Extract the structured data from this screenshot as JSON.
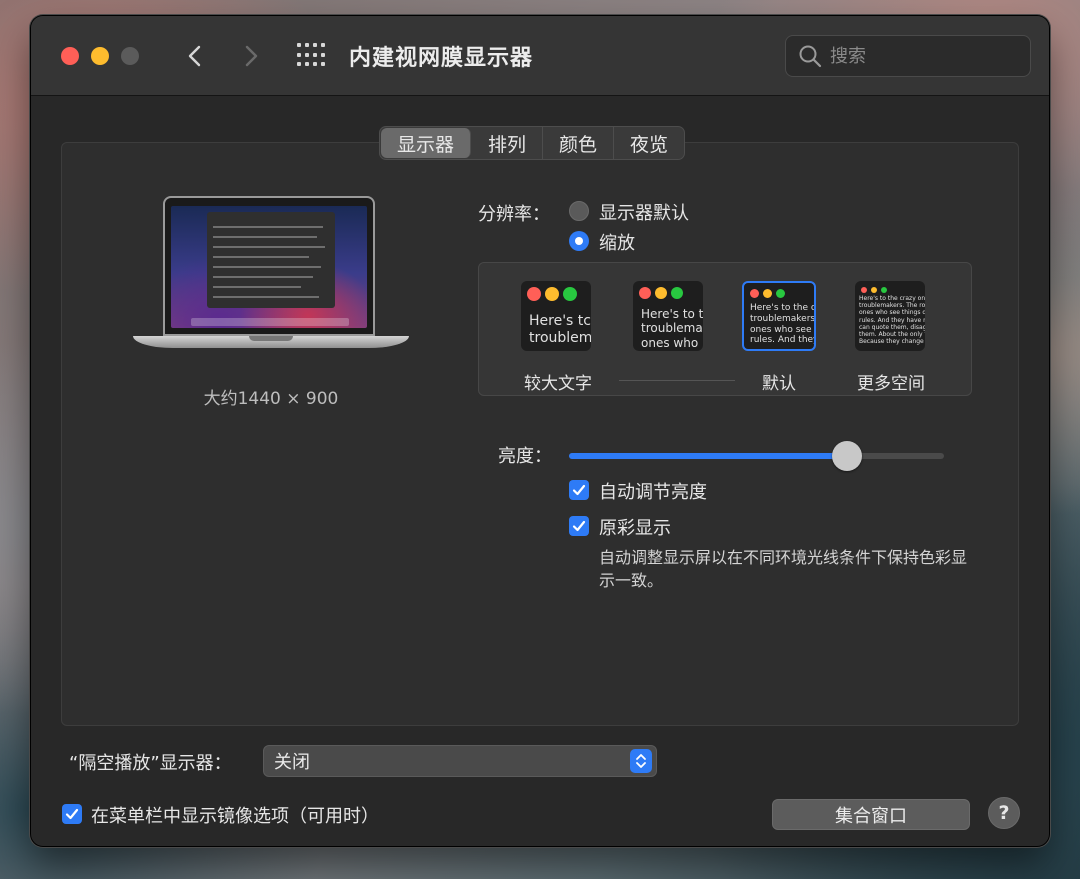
{
  "window": {
    "title": "内建视网膜显示器"
  },
  "search": {
    "placeholder": "搜索"
  },
  "tabs": [
    {
      "label": "显示器",
      "active": true
    },
    {
      "label": "排列",
      "active": false
    },
    {
      "label": "颜色",
      "active": false
    },
    {
      "label": "夜览",
      "active": false
    }
  ],
  "display": {
    "resolution_caption": "大约1440 × 900"
  },
  "resolution": {
    "label": "分辨率：",
    "options": [
      {
        "label": "显示器默认",
        "selected": false
      },
      {
        "label": "缩放",
        "selected": true
      }
    ]
  },
  "scale_options": [
    {
      "preview_lines": "Here's tc\ntroublem",
      "label": "较大文字"
    },
    {
      "preview_lines": "Here's to t\ntroublema\nones who",
      "label": ""
    },
    {
      "preview_lines": "Here's to the cr\ntroublemakers.\nones who see t\nrules. And they",
      "label": "默认",
      "selected": true
    },
    {
      "preview_lines": "Here's to the crazy one\ntroublemakers. The rou\nones who see things dif\nrules. And they have no\ncan quote them, disagre\nthem. About the only th\nBecause they change th",
      "label": "更多空间"
    }
  ],
  "brightness": {
    "label": "亮度：",
    "value": 0.74
  },
  "checkboxes": {
    "auto_brightness": {
      "label": "自动调节亮度",
      "checked": true
    },
    "true_tone": {
      "label": "原彩显示",
      "checked": true,
      "description": "自动调整显示屏以在不同环境光线条件下保持色彩显示一致。"
    }
  },
  "airplay": {
    "label": "“隔空播放”显示器：",
    "value": "关闭"
  },
  "mirroring": {
    "label": "在菜单栏中显示镜像选项（可用时）",
    "checked": true
  },
  "buttons": {
    "gather_windows": "集合窗口",
    "help": "?"
  },
  "colors": {
    "accent": "#2e7bf6",
    "window_bg": "#282828",
    "traffic_red": "#ff5f57",
    "traffic_yellow": "#febc2e",
    "traffic_green": "#28c840"
  }
}
